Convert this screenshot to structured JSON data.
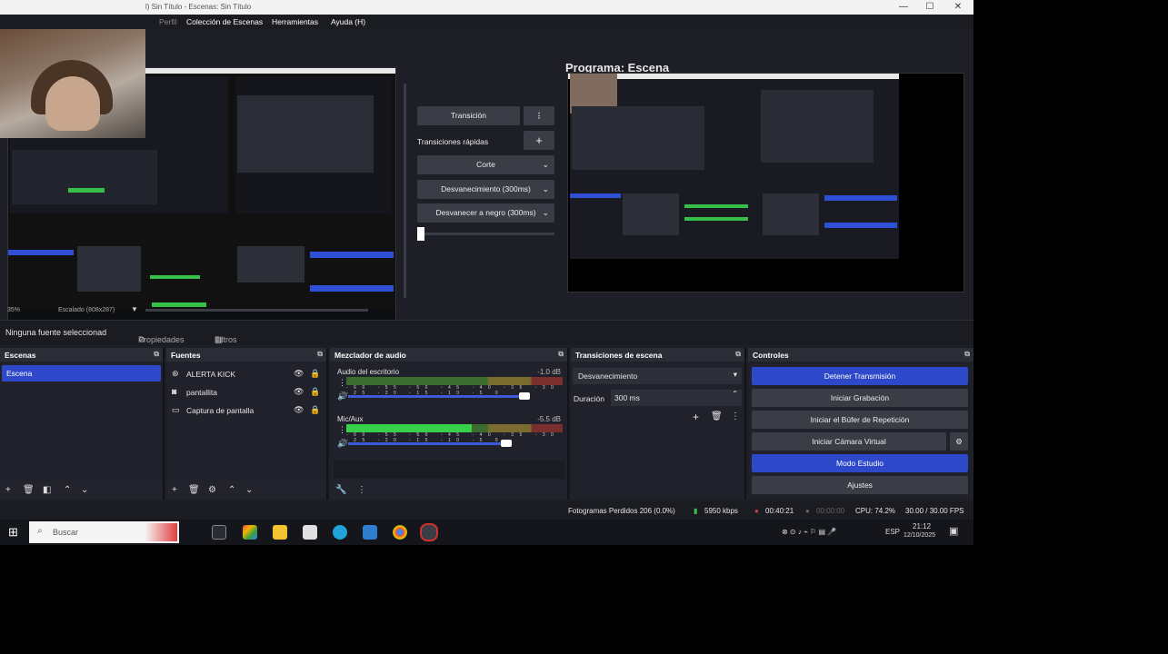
{
  "window": {
    "title": "l) Sin Título - Escenas: Sin Título",
    "minimize": "—",
    "maximize": "☐",
    "close": "✕"
  },
  "menu": {
    "items": [
      "Perfil",
      "Colección de Escenas",
      "Herramientas",
      "Ayuda (H)"
    ]
  },
  "program": {
    "title": "Programa: Escena"
  },
  "transitions_panel": {
    "transition_label": "Transición",
    "quick_label": "Transiciones rápidas",
    "options": [
      "Corte",
      "Desvanecimiento (300ms)",
      "Desvanecer a negro (300ms)"
    ]
  },
  "preview_footer": {
    "zoom": "35%",
    "scaled": "Escalado (808x287)"
  },
  "source_toolbar": {
    "no_source": "Ninguna fuente seleccionad",
    "properties": "Propiedades",
    "filters": "Filtros"
  },
  "scenes": {
    "title": "Escenas",
    "items": [
      "Escena"
    ]
  },
  "sources": {
    "title": "Fuentes",
    "items": [
      {
        "icon": "alert-icon",
        "glyph": "⊛",
        "name": "ALERTA KICK"
      },
      {
        "icon": "camera-icon",
        "glyph": "◙",
        "name": "pantallita"
      },
      {
        "icon": "monitor-icon",
        "glyph": "▭",
        "name": "Captura de pantalla"
      }
    ]
  },
  "mixer": {
    "title": "Mezclador de audio",
    "channels": [
      {
        "name": "Audio del escritorio",
        "db": "-1.0 dB",
        "level": 0,
        "volume": 0.98
      },
      {
        "name": "Mic/Aux",
        "db": "-5.5 dB",
        "level": 0.58,
        "volume": 0.88
      }
    ],
    "ticks": "-60 -55 -50 -45 -40 -35 -30 -25 -20 -15 -10 -5 0"
  },
  "scene_transitions": {
    "title": "Transiciones de escena",
    "selected": "Desvanecimiento",
    "duration_label": "Duración",
    "duration_value": "300 ms"
  },
  "controls": {
    "title": "Controles",
    "buttons": [
      {
        "label": "Detener Transmisión",
        "active": true
      },
      {
        "label": "Iniciar Grabación",
        "active": false
      },
      {
        "label": "Iniciar el Búfer de Repetición",
        "active": false
      },
      {
        "label": "Iniciar Cámara Virtual",
        "active": false
      },
      {
        "label": "Modo Estudio",
        "active": true
      },
      {
        "label": "Ajustes",
        "active": false
      }
    ]
  },
  "status": {
    "dropped": "Fotogramas Perdidos 206 (0.0%)",
    "kbps": "5950 kbps",
    "live_time": "00:40:21",
    "rec_time": "00:00:00",
    "cpu": "CPU: 74.2%",
    "fps": "30.00 / 30.00 FPS"
  },
  "taskbar": {
    "search": "Buscar",
    "lang": "ESP",
    "time": "21:12",
    "date": "12/10/2025"
  },
  "colors": {
    "accent": "#2d48c8",
    "panel": "#20212a",
    "meter_green": "#38d048"
  }
}
